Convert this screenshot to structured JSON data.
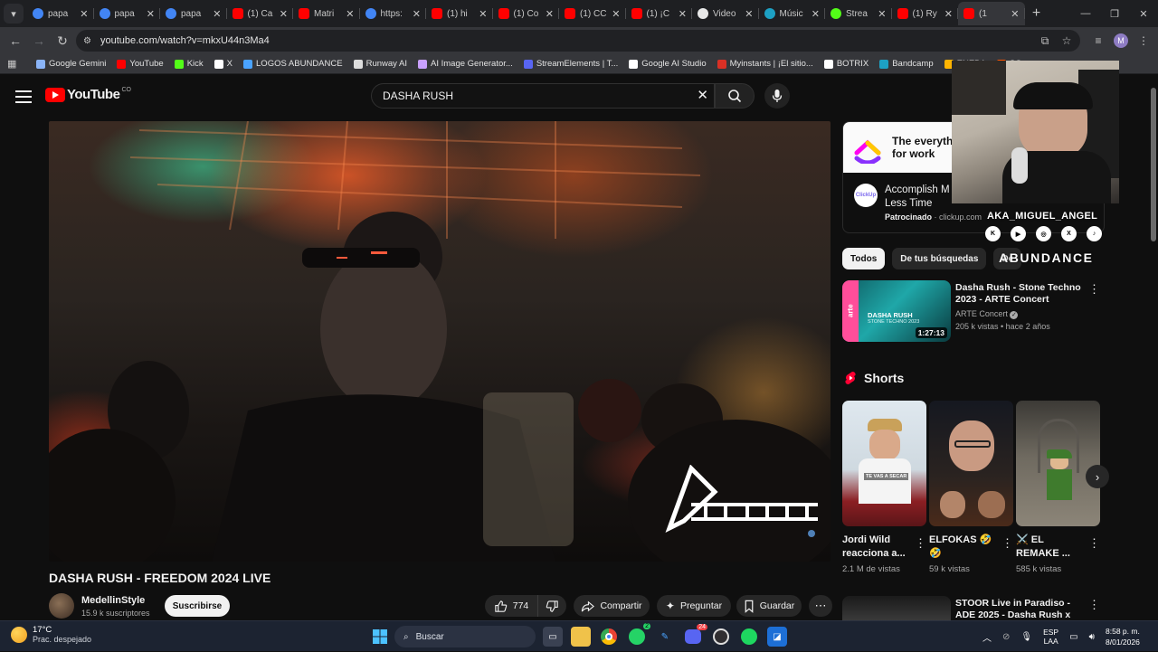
{
  "browser": {
    "tabs": [
      {
        "label": "papa",
        "icon": "google",
        "color": "#4285f4"
      },
      {
        "label": "papa",
        "icon": "google",
        "color": "#4285f4"
      },
      {
        "label": "papa",
        "icon": "google",
        "color": "#4285f4"
      },
      {
        "label": "(1) Ca",
        "icon": "youtube",
        "color": "#ff0000"
      },
      {
        "label": "Matri",
        "icon": "youtube",
        "color": "#ff0000"
      },
      {
        "label": "https:",
        "icon": "google",
        "color": "#4285f4"
      },
      {
        "label": "(1) hi",
        "icon": "youtube",
        "color": "#ff0000"
      },
      {
        "label": "(1) Co",
        "icon": "youtube",
        "color": "#ff0000"
      },
      {
        "label": "(1) CC",
        "icon": "youtube",
        "color": "#ff0000"
      },
      {
        "label": "(1) ¡C",
        "icon": "youtube",
        "color": "#ff0000"
      },
      {
        "label": "Video",
        "icon": "doc",
        "color": "#e8e8e8"
      },
      {
        "label": "Músic",
        "icon": "bandcamp",
        "color": "#1da0c3"
      },
      {
        "label": "Strea",
        "icon": "kick",
        "color": "#53fc18"
      },
      {
        "label": "(1) Ry",
        "icon": "youtube",
        "color": "#ff0000"
      },
      {
        "label": "(1",
        "icon": "youtube",
        "color": "#ff0000",
        "active": true
      }
    ],
    "url": "youtube.com/watch?v=mkxU44n3Ma4",
    "profile_initial": "M",
    "bookmarks": [
      {
        "label": "Google Gemini",
        "color": "#8ab4f8"
      },
      {
        "label": "YouTube",
        "color": "#ff0000"
      },
      {
        "label": "Kick",
        "color": "#53fc18"
      },
      {
        "label": "X",
        "color": "#ffffff"
      },
      {
        "label": "LOGOS ABUNDANCE",
        "color": "#4aa3ff"
      },
      {
        "label": "Runway AI",
        "color": "#dddddd"
      },
      {
        "label": "AI Image Generator...",
        "color": "#c9a0ff"
      },
      {
        "label": "StreamElements | T...",
        "color": "#5865f2"
      },
      {
        "label": "Google AI Studio",
        "color": "#ffffff"
      },
      {
        "label": "Myinstants | ¡El sitio...",
        "color": "#d93025"
      },
      {
        "label": "BOTRIX",
        "color": "#ffffff"
      },
      {
        "label": "Bandcamp",
        "color": "#1da0c3"
      },
      {
        "label": "ENEBA",
        "color": "#ffb400"
      },
      {
        "label": "SO",
        "color": "#ff5500"
      }
    ]
  },
  "youtube": {
    "logo_word": "YouTube",
    "logo_country": "CO",
    "search_value": "DASHA RUSH",
    "video": {
      "title": "DASHA RUSH - FREEDOM 2024 LIVE",
      "channel": "MedellinStyle",
      "subscribers": "15.9 k suscriptores",
      "subscribe_label": "Suscribirse",
      "likes": "774",
      "share_label": "Compartir",
      "ask_label": "Preguntar",
      "save_label": "Guardar"
    },
    "ad": {
      "headline_line1": "The everyth",
      "headline_line2": "for work",
      "text_line1": "Accomplish M",
      "text_line2": "Less Time",
      "sponsored_label": "Patrocinado",
      "domain": "clickup.com",
      "icon_label": "ClickUp"
    },
    "filters": [
      {
        "label": "Todos",
        "selected": true
      },
      {
        "label": "De tus búsquedas",
        "selected": false
      },
      {
        "label": "De",
        "selected": false
      }
    ],
    "recommendations": [
      {
        "title": "Dasha Rush - Stone Techno 2023 - ARTE Concert",
        "channel": "ARTE Concert",
        "verified": true,
        "meta": "205 k vistas • hace 2 años",
        "duration": "1:27:13",
        "thumb_text_1": "DASHA RUSH",
        "thumb_text_2": "STONE TECHNO 2023",
        "thumb_side": "arte"
      },
      {
        "title": "STOOR Live in Paradiso - ADE 2025 - Dasha Rush x Fadi",
        "channel": "",
        "meta": "",
        "duration": ""
      }
    ],
    "shorts_title": "Shorts",
    "shorts": [
      {
        "title": "Jordi Wild reacciona a...",
        "views": "2.1 M de vistas",
        "caption": "TE VAS A SECAR"
      },
      {
        "title": "ELFOKAS 🤣 🤣",
        "views": "59 k vistas",
        "caption": ""
      },
      {
        "title": "⚔️ EL REMAKE ...",
        "views": "585 k vistas",
        "caption": ""
      }
    ]
  },
  "overlay": {
    "handle": "AKA_MIGUEL_ANGEL",
    "brand": "ABUNDANCE",
    "social": [
      "kick",
      "youtube",
      "instagram",
      "x",
      "tiktok"
    ],
    "video_logo": "FREEDOM"
  },
  "taskbar": {
    "weather_temp": "17°C",
    "weather_desc": "Prac. despejado",
    "search_label": "Buscar",
    "lang_line1": "ESP",
    "lang_line2": "LAA",
    "time": "8:58 p. m.",
    "date": "8/01/2026",
    "badge_whatsapp": "2",
    "badge_discord": "24"
  }
}
